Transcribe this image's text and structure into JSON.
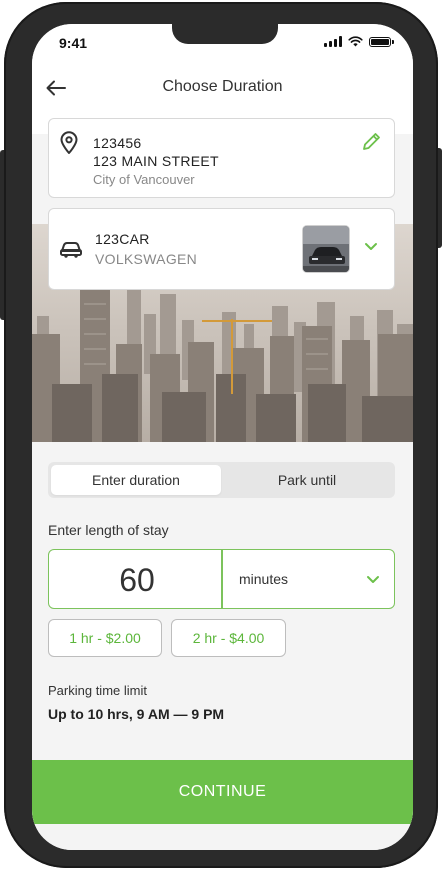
{
  "status_bar": {
    "time": "9:41"
  },
  "header": {
    "title": "Choose Duration"
  },
  "location": {
    "code": "123456",
    "street": "123 MAIN STREET",
    "city": "City of Vancouver"
  },
  "vehicle": {
    "plate": "123CAR",
    "make": "VOLKSWAGEN"
  },
  "tabs": [
    {
      "label": "Enter duration",
      "active": true
    },
    {
      "label": "Park until",
      "active": false
    }
  ],
  "stay": {
    "label": "Enter length of stay",
    "value": "60",
    "unit": "minutes"
  },
  "presets": [
    {
      "label": "1 hr - $2.00"
    },
    {
      "label": "2 hr - $4.00"
    }
  ],
  "limit": {
    "label": "Parking time limit",
    "value": "Up to 10 hrs, 9 AM — 9 PM"
  },
  "actions": {
    "continue_label": "CONTINUE"
  },
  "icons": {
    "back": "arrow-left-icon",
    "location": "map-pin-icon",
    "edit": "pencil-icon",
    "vehicle": "car-icon",
    "chevron": "chevron-down-icon"
  },
  "colors": {
    "accent": "#6cc04a",
    "accent_text": "#5cb63b",
    "border": "#d8d8d8",
    "background": "#f4f4f4"
  }
}
